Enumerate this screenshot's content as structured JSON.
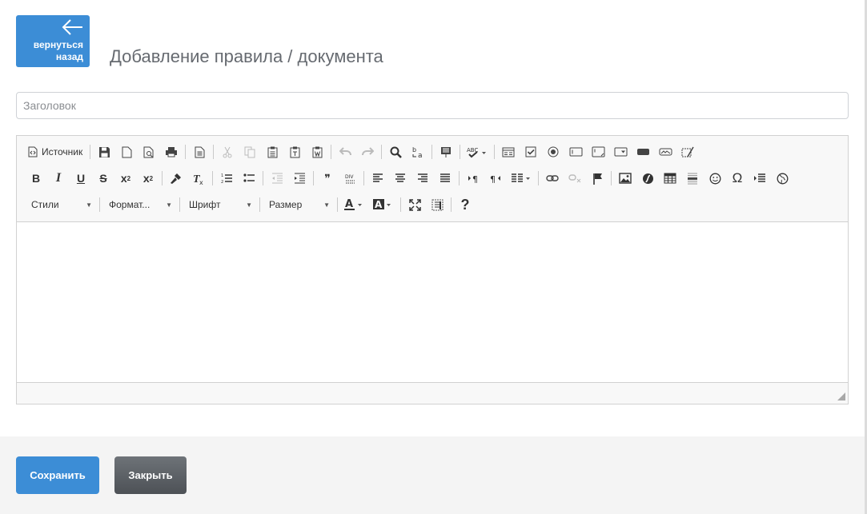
{
  "header": {
    "back_line1": "вернуться",
    "back_line2": "назад",
    "title": "Добавление правила / документа"
  },
  "form": {
    "title_placeholder": "Заголовок",
    "title_value": ""
  },
  "editor": {
    "source_label": "Источник",
    "combos": {
      "styles": "Стили",
      "format": "Формат...",
      "font": "Шрифт",
      "size": "Размер"
    },
    "bold": "B",
    "italic": "I",
    "underline": "U",
    "strike": "S",
    "subscript_base": "x",
    "subscript_mark": "2",
    "superscript_base": "x",
    "superscript_mark": "2",
    "help": "?",
    "omega": "Ω",
    "quote": "❞",
    "body_text": ""
  },
  "footer": {
    "save_label": "Сохранить",
    "close_label": "Закрыть"
  },
  "colors": {
    "primary": "#3c8dd6",
    "secondary": "#5a5e63",
    "footer_bg": "#f4f4f4"
  }
}
